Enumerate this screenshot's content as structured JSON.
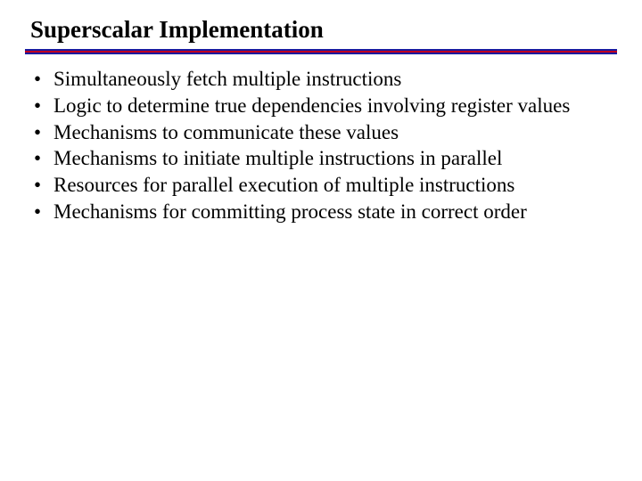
{
  "title": "Superscalar Implementation",
  "bullets": [
    "Simultaneously fetch multiple instructions",
    "Logic to determine true dependencies involving register values",
    "Mechanisms to communicate these values",
    "Mechanisms to initiate multiple instructions in parallel",
    "Resources for parallel execution of multiple instructions",
    "Mechanisms for committing process state in correct order"
  ]
}
